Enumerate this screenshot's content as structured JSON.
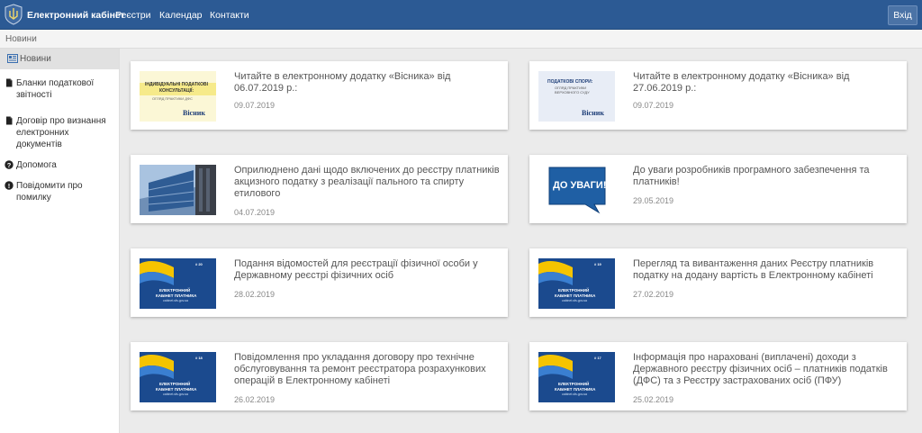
{
  "header": {
    "brand": "Електронний кабінет",
    "nav": [
      "Реєстри",
      "Календар",
      "Контакти"
    ],
    "login": "Вхід"
  },
  "breadcrumb": "Новини",
  "sidebar": {
    "items": [
      {
        "label": "Новини",
        "icon": "newspaper-icon"
      },
      {
        "label": "Бланки податкової звітності",
        "icon": "document-icon"
      },
      {
        "label": "Договір про визнання електронних документів",
        "icon": "document-icon"
      },
      {
        "label": "Допомога",
        "icon": "question-icon"
      },
      {
        "label": "Повідомити про помилку",
        "icon": "info-icon"
      }
    ]
  },
  "news": [
    {
      "title": "Читайте в електронному додатку «Вісника» від 06.07.2019 р.:",
      "date": "09.07.2019",
      "thumb": "vysnyk-consultations"
    },
    {
      "title": "Читайте в електронному додатку «Вісника» від 27.06.2019 р.:",
      "date": "09.07.2019",
      "thumb": "vysnyk-disputes"
    },
    {
      "title": "Оприлюднено дані щодо включених до реєстру платників акцизного податку з реалізації пального та спирту етилового",
      "date": "04.07.2019",
      "thumb": "building-photo"
    },
    {
      "title": "До уваги розробників програмного забезпечення та платників!",
      "date": "29.05.2019",
      "thumb": "attention-bubble"
    },
    {
      "title": "Подання відомостей для реєстрації фізичної особи у Державному реєстрі фізичних осіб",
      "date": "28.02.2019",
      "thumb": "cabinet-flag"
    },
    {
      "title": "Перегляд та вивантаження даних Реєстру платників податку на додану вартість в Електронному кабінеті",
      "date": "27.02.2019",
      "thumb": "cabinet-flag"
    },
    {
      "title": "Повідомлення про укладання договору про технічне обслуговування та ремонт реєстратора розрахункових операцій в Електронному кабінеті",
      "date": "26.02.2019",
      "thumb": "cabinet-flag"
    },
    {
      "title": "Інформація про нараховані (виплачені) доходи з Державного реєстру фізичних осіб – платників податків (ДФС) та з Реєстру застрахованих осіб (ПФУ)",
      "date": "25.02.2019",
      "thumb": "cabinet-flag"
    }
  ],
  "thumb_text": {
    "consult_line1": "ІНДИВІДУАЛЬНІ ПОДАТКОВІ",
    "consult_line2": "КОНСУЛЬТАЦІЇ:",
    "consult_line3": "ОГЛЯД ПРАКТИКИ ДФС",
    "disputes_line1": "ПОДАТКОВІ СПОРИ:",
    "disputes_line2": "ОГЛЯД ПРАКТИКИ",
    "disputes_line3": "ВЕРХОВНОГО СУДУ",
    "vysnyk": "Вісник",
    "attention": "ДО УВАГИ!",
    "cabinet_line1": "ЕЛЕКТРОННИЙ",
    "cabinet_line2": "КАБІНЕТ ПЛАТНИКА",
    "cabinet_url": "cabinet.sfs.gov.ua",
    "badges": [
      "# 20",
      "# 19",
      "# 18",
      "# 17"
    ]
  },
  "colors": {
    "navbar": "#2c5a94",
    "background": "#ebebeb",
    "attention_blue": "#1f5fa4",
    "cabinet_blue": "#1b4a8e",
    "flag_yellow": "#f5c400"
  }
}
